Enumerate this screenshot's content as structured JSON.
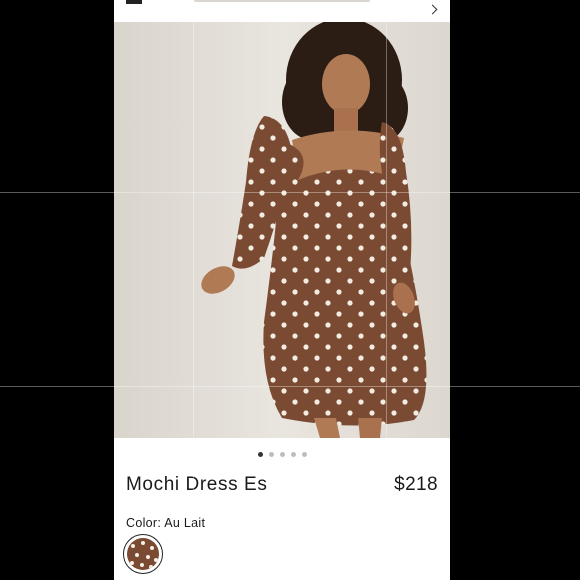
{
  "product": {
    "title": "Mochi Dress Es",
    "price": "$218",
    "color_label": "Color:",
    "color_value": "Au Lait",
    "color_hex": "#7a4a33",
    "pattern": "white polka dots"
  },
  "carousel": {
    "total": 5,
    "active_index": 0
  },
  "colors": {
    "background": "#000000",
    "screen": "#ffffff",
    "text": "#1a1a1a",
    "dot_active": "#333333",
    "dot_inactive": "#bdbdbd"
  },
  "icons": {
    "top_right": "chevron-icon"
  }
}
